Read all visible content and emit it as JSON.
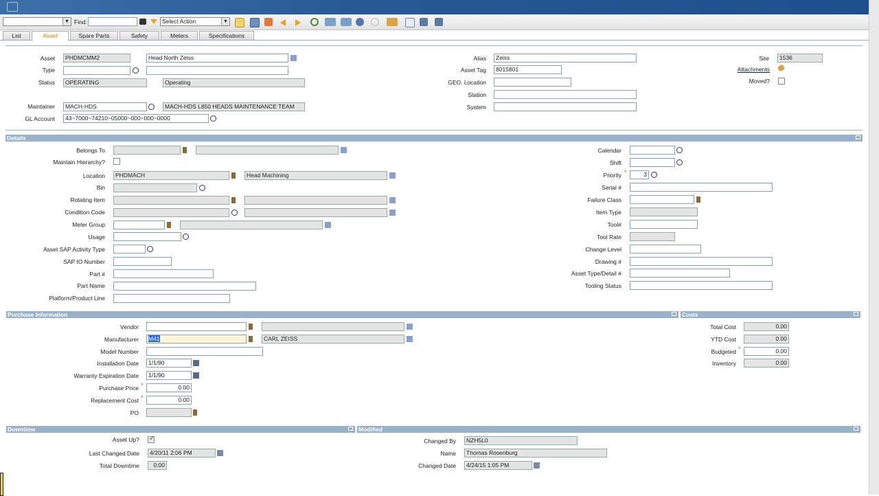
{
  "toolbar": {
    "find_label": "Find:",
    "action_select": "Select Action"
  },
  "tabs": [
    "List",
    "Asset",
    "Spare Parts",
    "Safety",
    "Meters",
    "Specifications"
  ],
  "header": {
    "asset_label": "Asset",
    "asset": "PHDMCMM2",
    "asset_desc": "Head North Zeiss",
    "type_label": "Type",
    "status_label": "Status",
    "status": "OPERATING",
    "status_desc": "Operating",
    "maintainer_label": "Maintainer",
    "maintainer": "MACH-HDS",
    "maintainer_desc": "MACH-HDS L850 HEADS MAINTENANCE TEAM",
    "gl_label": "GL Account",
    "gl": "43~7000~74210~05000~000~000~0000",
    "alias_label": "Alias",
    "alias": "Zeiss",
    "tag_label": "Asset Tag",
    "tag": "8015801",
    "geo_label": "GEO. Location",
    "station_label": "Station",
    "system_label": "System",
    "site_label": "Site",
    "site": "1536",
    "attachments": "Attachments",
    "moved_label": "Moved?"
  },
  "details": {
    "title": "Details",
    "belongs_label": "Belongs To",
    "maintain_label": "Maintain Hierarchy?",
    "location_label": "Location",
    "location": "PHDMACH",
    "location_desc": "Head Machining",
    "bin_label": "Bin",
    "rotating_label": "Rotating Item",
    "condition_label": "Condition Code",
    "meter_group_label": "Meter Group",
    "usage_label": "Usage",
    "sap_type_label": "Asset SAP Activity Type",
    "sap_io_label": "SAP IO Number",
    "part_label": "Part #",
    "part_name_label": "Part Name",
    "platform_label": "Platform/Product Line",
    "calendar_label": "Calendar",
    "shift_label": "Shift",
    "priority_label": "Priority",
    "priority": "3",
    "serial_label": "Serial #",
    "failure_label": "Failure Class",
    "item_type_label": "Item Type",
    "tool_label": "Tool#",
    "tool_rate_label": "Tool Rate",
    "change_level_label": "Change Level",
    "drawing_label": "Drawing #",
    "asset_type_label": "Asset Type/Detail #",
    "tooling_status_label": "Tooling Status"
  },
  "purchase": {
    "title": "Purchase Information",
    "vendor_label": "Vendor",
    "manufacturer_label": "Manufacturer",
    "manufacturer": "M41",
    "manufacturer_desc": "CARL ZEISS",
    "model_label": "Model Number",
    "install_label": "Installation Date",
    "install": "1/1/90",
    "warranty_label": "Warranty Expiration Date",
    "warranty": "1/1/90",
    "price_label": "Purchase Price",
    "price": "0.00",
    "replace_label": "Replacement Cost",
    "replace": "0.00",
    "po_label": "PO"
  },
  "costs": {
    "title": "Costs",
    "total_label": "Total Cost",
    "total": "0.00",
    "ytd_label": "YTD Cost",
    "ytd": "0.00",
    "budget_label": "Budgeted",
    "budget": "0.00",
    "inventory_label": "Inventory",
    "inventory": "0.00"
  },
  "downtime": {
    "title": "Downtime",
    "up_label": "Asset Up?",
    "last_label": "Last Changed Date",
    "last": "4/20/11 2:06 PM",
    "total_label": "Total Downtime",
    "total": "0:00"
  },
  "modified": {
    "title": "Modified",
    "by_label": "Changed By",
    "by": "NZH5L0",
    "name_label": "Name",
    "name": "Thomas Rosenburg",
    "date_label": "Changed Date",
    "date": "4/24/15 1:05 PM"
  },
  "colors": {
    "header_blue": "#2a5a96",
    "section": "#9ab2c9",
    "active_tab": "#e07a00",
    "required": "#e0501b"
  }
}
